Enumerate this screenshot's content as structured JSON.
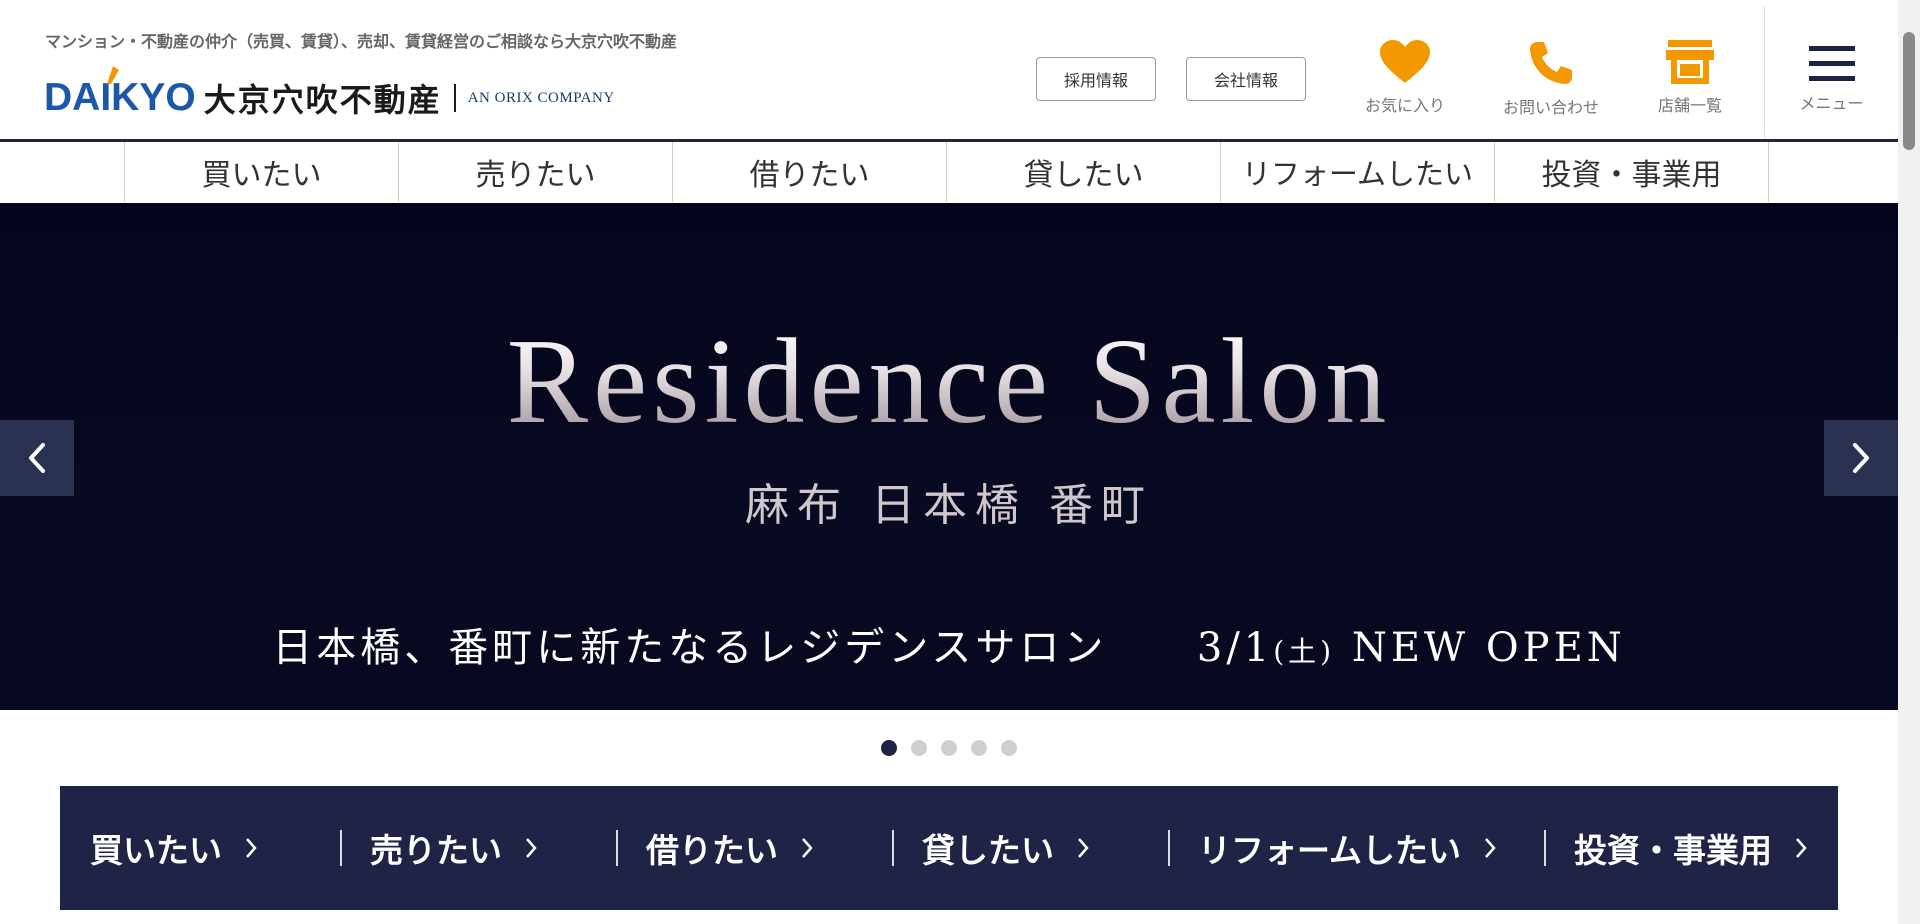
{
  "header": {
    "tagline": "マンション・不動産の仲介（売買、賃貸）、売却、賃貸経営のご相談なら大京穴吹不動産",
    "logo": {
      "brand": "DAIKYO",
      "name_jp": "大京穴吹不動産",
      "orix": "AN ORIX COMPANY"
    },
    "buttons": {
      "recruit": "採用情報",
      "company": "会社情報"
    },
    "icons": {
      "favorites": {
        "label": "お気に入り",
        "icon": "heart-icon"
      },
      "contact": {
        "label": "お問い合わせ",
        "icon": "phone-icon"
      },
      "stores": {
        "label": "店舗一覧",
        "icon": "store-icon"
      },
      "menu": {
        "label": "メニュー",
        "icon": "hamburger-icon"
      }
    },
    "accent_color": "#f39800",
    "navy_color": "#1f2346"
  },
  "top_nav": [
    "買いたい",
    "売りたい",
    "借りたい",
    "貸したい",
    "リフォームしたい",
    "投資・事業用"
  ],
  "hero": {
    "title": "Residence Salon",
    "subtitle": "麻布 日本橋 番町",
    "tagline_main": "日本橋、番町に新たなるレジデンスサロン",
    "date": "3/1",
    "day": "(土)",
    "open": "NEW OPEN",
    "slide_count": 5,
    "active_slide": 1
  },
  "bottom_nav": [
    "買いたい",
    "売りたい",
    "借りたい",
    "貸したい",
    "リフォームしたい",
    "投資・事業用"
  ]
}
